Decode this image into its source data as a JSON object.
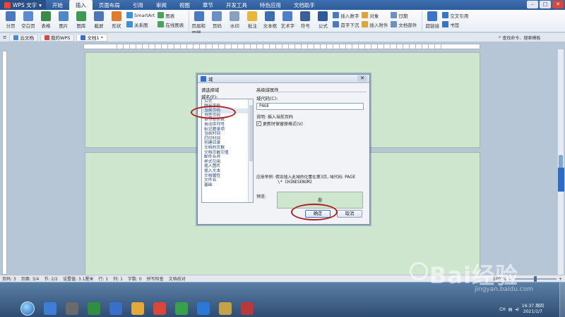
{
  "app": {
    "name": "WPS 文字"
  },
  "menu_tabs": [
    "开始",
    "插入",
    "页面布局",
    "引用",
    "审阅",
    "视图",
    "章节",
    "开发工具",
    "特色应用",
    "文档助手"
  ],
  "active_menu": "插入",
  "ribbon": {
    "big": [
      {
        "label": "分页",
        "color": "#4a79c2"
      },
      {
        "label": "空白页",
        "color": "#5b8bd0"
      },
      {
        "label": "表格",
        "color": "#3a8a4a"
      },
      {
        "label": "图片",
        "color": "#4e88c9"
      },
      {
        "label": "图库",
        "color": "#3f9b54"
      },
      {
        "label": "截屏",
        "color": "#5077b5"
      },
      {
        "label": "形状",
        "color": "#e07b2a"
      }
    ],
    "col1": [
      "SmartArt",
      "关系图"
    ],
    "col1b": [
      "图表",
      "在线图表"
    ],
    "big2": [
      {
        "label": "页眉和页脚",
        "color": "#4a79c2"
      },
      {
        "label": "页码",
        "color": "#6c8fc4"
      },
      {
        "label": "水印",
        "color": "#8aa0bf"
      },
      {
        "label": "批注",
        "color": "#e9b63a"
      },
      {
        "label": "文本框",
        "color": "#3e6db2"
      },
      {
        "label": "艺术字",
        "color": "#4f7fc7"
      },
      {
        "label": "符号",
        "color": "#3b5f9a"
      },
      {
        "label": "公式",
        "color": "#2f5a96"
      }
    ],
    "col2": [
      "插入数字",
      "首字下沉"
    ],
    "col2b": [
      "对象",
      "插入附件"
    ],
    "col3": [
      "日期",
      "文档部件"
    ],
    "big3": [
      {
        "label": "超链接",
        "color": "#3b74c6"
      }
    ],
    "col4": [
      "交叉引用",
      "书签"
    ]
  },
  "doc_tabs": [
    {
      "label": "云文档",
      "color": "#4a88d6",
      "active": false
    },
    {
      "label": "我的WPS",
      "color": "#d9463a",
      "active": false
    },
    {
      "label": "文档1 *",
      "color": "#2e6fcf",
      "active": true
    }
  ],
  "search_placeholder": "查找命令、搜索模板",
  "dialog": {
    "title": "域",
    "left_group": "请选择域",
    "field_name_label": "域名(F):",
    "fields": [
      "公式",
      "跳至字段",
      "当前页码",
      "书签页码",
      "本节总页数",
      "自动序列号",
      "标记题录项",
      "当前时间",
      "打印时间",
      "创建目录",
      "文档的页数",
      "文档页嵌引值",
      "邮件合并",
      "样式引用",
      "插入图片",
      "插入文本",
      "文档属性",
      "文件名",
      "基础"
    ],
    "selected_index": 2,
    "advanced_label": "高级域属性",
    "field_code_label": "域代码(C):",
    "field_code_value": "PAGE",
    "description": "说明: 插入当前页码",
    "keep_format": "更新时保留原格式(V)",
    "example_line1": "应用举例: 假设插入此域的位置在第3页, 域代码: PAGE",
    "example_line2": "\\* CHINESENUM2",
    "preview_label": "预览:",
    "preview_value": "叁",
    "ok": "确定",
    "cancel": "取消"
  },
  "status": {
    "items": [
      "页码: 3",
      "页面: 3/4",
      "节: 2/2",
      "设置值: 3.1厘米",
      "行: 1",
      "列: 1",
      "字数: 0",
      "拼写检查",
      "文档校对"
    ],
    "zoom": "100 %"
  },
  "taskbar": {
    "icons": [
      {
        "color": "#3e7ed8"
      },
      {
        "color": "#6a6a6a"
      },
      {
        "color": "#2f8f3e"
      },
      {
        "color": "#3a6fc9"
      },
      {
        "color": "#e2a93b"
      },
      {
        "color": "#d9463a"
      },
      {
        "color": "#37a14b"
      },
      {
        "color": "#2c78d6"
      },
      {
        "color": "#c4a24a"
      },
      {
        "color": "#b63a3a"
      }
    ],
    "time": "16:37 周四",
    "date": "2021/1/7",
    "tray": [
      "CH"
    ]
  },
  "watermark": {
    "text": "Bai经验",
    "url": "jingyan.baidu.com"
  }
}
